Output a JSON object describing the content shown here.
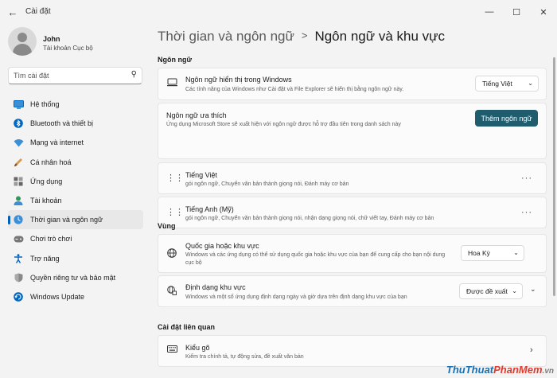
{
  "window": {
    "title": "Cài đặt",
    "controls": [
      "—",
      "☐",
      "✕"
    ]
  },
  "profile": {
    "name": "John",
    "account_type": "Tài khoản Cục bộ"
  },
  "search": {
    "placeholder": "Tìm cài đặt"
  },
  "sidebar": {
    "items": [
      {
        "label": "Hệ thống",
        "icon": "system-icon",
        "color": "#0067c0"
      },
      {
        "label": "Bluetooth và thiết bị",
        "icon": "bluetooth-icon",
        "color": "#0067c0"
      },
      {
        "label": "Mạng và internet",
        "icon": "network-icon",
        "color": "#0067c0"
      },
      {
        "label": "Cá nhân hoá",
        "icon": "personalization-icon",
        "color": "#c07a3a"
      },
      {
        "label": "Ứng dụng",
        "icon": "apps-icon",
        "color": "#555555"
      },
      {
        "label": "Tài khoản",
        "icon": "accounts-icon",
        "color": "#2e9a5a"
      },
      {
        "label": "Thời gian và ngôn ngữ",
        "icon": "time-language-icon",
        "color": "#0067c0",
        "active": true
      },
      {
        "label": "Chơi trò chơi",
        "icon": "gaming-icon",
        "color": "#666666"
      },
      {
        "label": "Trợ năng",
        "icon": "accessibility-icon",
        "color": "#0067c0"
      },
      {
        "label": "Quyền riêng tư và bảo mật",
        "icon": "privacy-shield-icon",
        "color": "#666666"
      },
      {
        "label": "Windows Update",
        "icon": "windows-update-icon",
        "color": "#0067c0"
      }
    ]
  },
  "breadcrumb": {
    "parent": "Thời gian và ngôn ngữ",
    "separator": ">",
    "current": "Ngôn ngữ và khu vực"
  },
  "language_section": {
    "title": "Ngôn ngữ",
    "display_language": {
      "title": "Ngôn ngữ hiển thị trong Windows",
      "description": "Các tính năng của Windows như Cài đặt và File Explorer sẽ hiển thị bằng ngôn ngữ này.",
      "selected": "Tiếng Việt"
    },
    "preferred": {
      "title": "Ngôn ngữ ưa thích",
      "description": "Ứng dụng Microsoft Store sẽ xuất hiện với ngôn ngữ được hỗ trợ đầu tiên trong danh sách này",
      "button": "Thêm ngôn ngữ"
    },
    "languages": [
      {
        "name": "Tiếng Việt",
        "description": "gói ngôn ngữ, Chuyển văn bản thành giọng nói, Đánh máy cơ bản"
      },
      {
        "name": "Tiếng Anh (Mỹ)",
        "description": "gói ngôn ngữ, Chuyển văn bản thành giọng nói, nhận dạng giọng nói, chữ viết tay, Đánh máy cơ bản"
      }
    ],
    "more_glyph": "···"
  },
  "region_section": {
    "title": "Vùng",
    "country": {
      "title": "Quốc gia hoặc khu vực",
      "description": "Windows và các ứng dụng có thể sử dụng quốc gia hoặc khu vực của bạn để cung cấp cho bạn nội dung cục bộ",
      "selected": "Hoa Kỳ"
    },
    "format": {
      "title": "Định dạng khu vực",
      "description": "Windows và một số ứng dụng định dạng ngày và giờ dựa trên định dạng khu vực của bạn",
      "selected": "Được đề xuất"
    }
  },
  "related_section": {
    "title": "Cài đặt liên quan",
    "typing": {
      "title": "Kiểu gõ",
      "description": "Kiểm tra chính tả, tự động sửa, đề xuất văn bản"
    }
  },
  "watermark": {
    "part1": "ThuThuat",
    "part2": "PhanMem",
    "part3": ".vn"
  }
}
